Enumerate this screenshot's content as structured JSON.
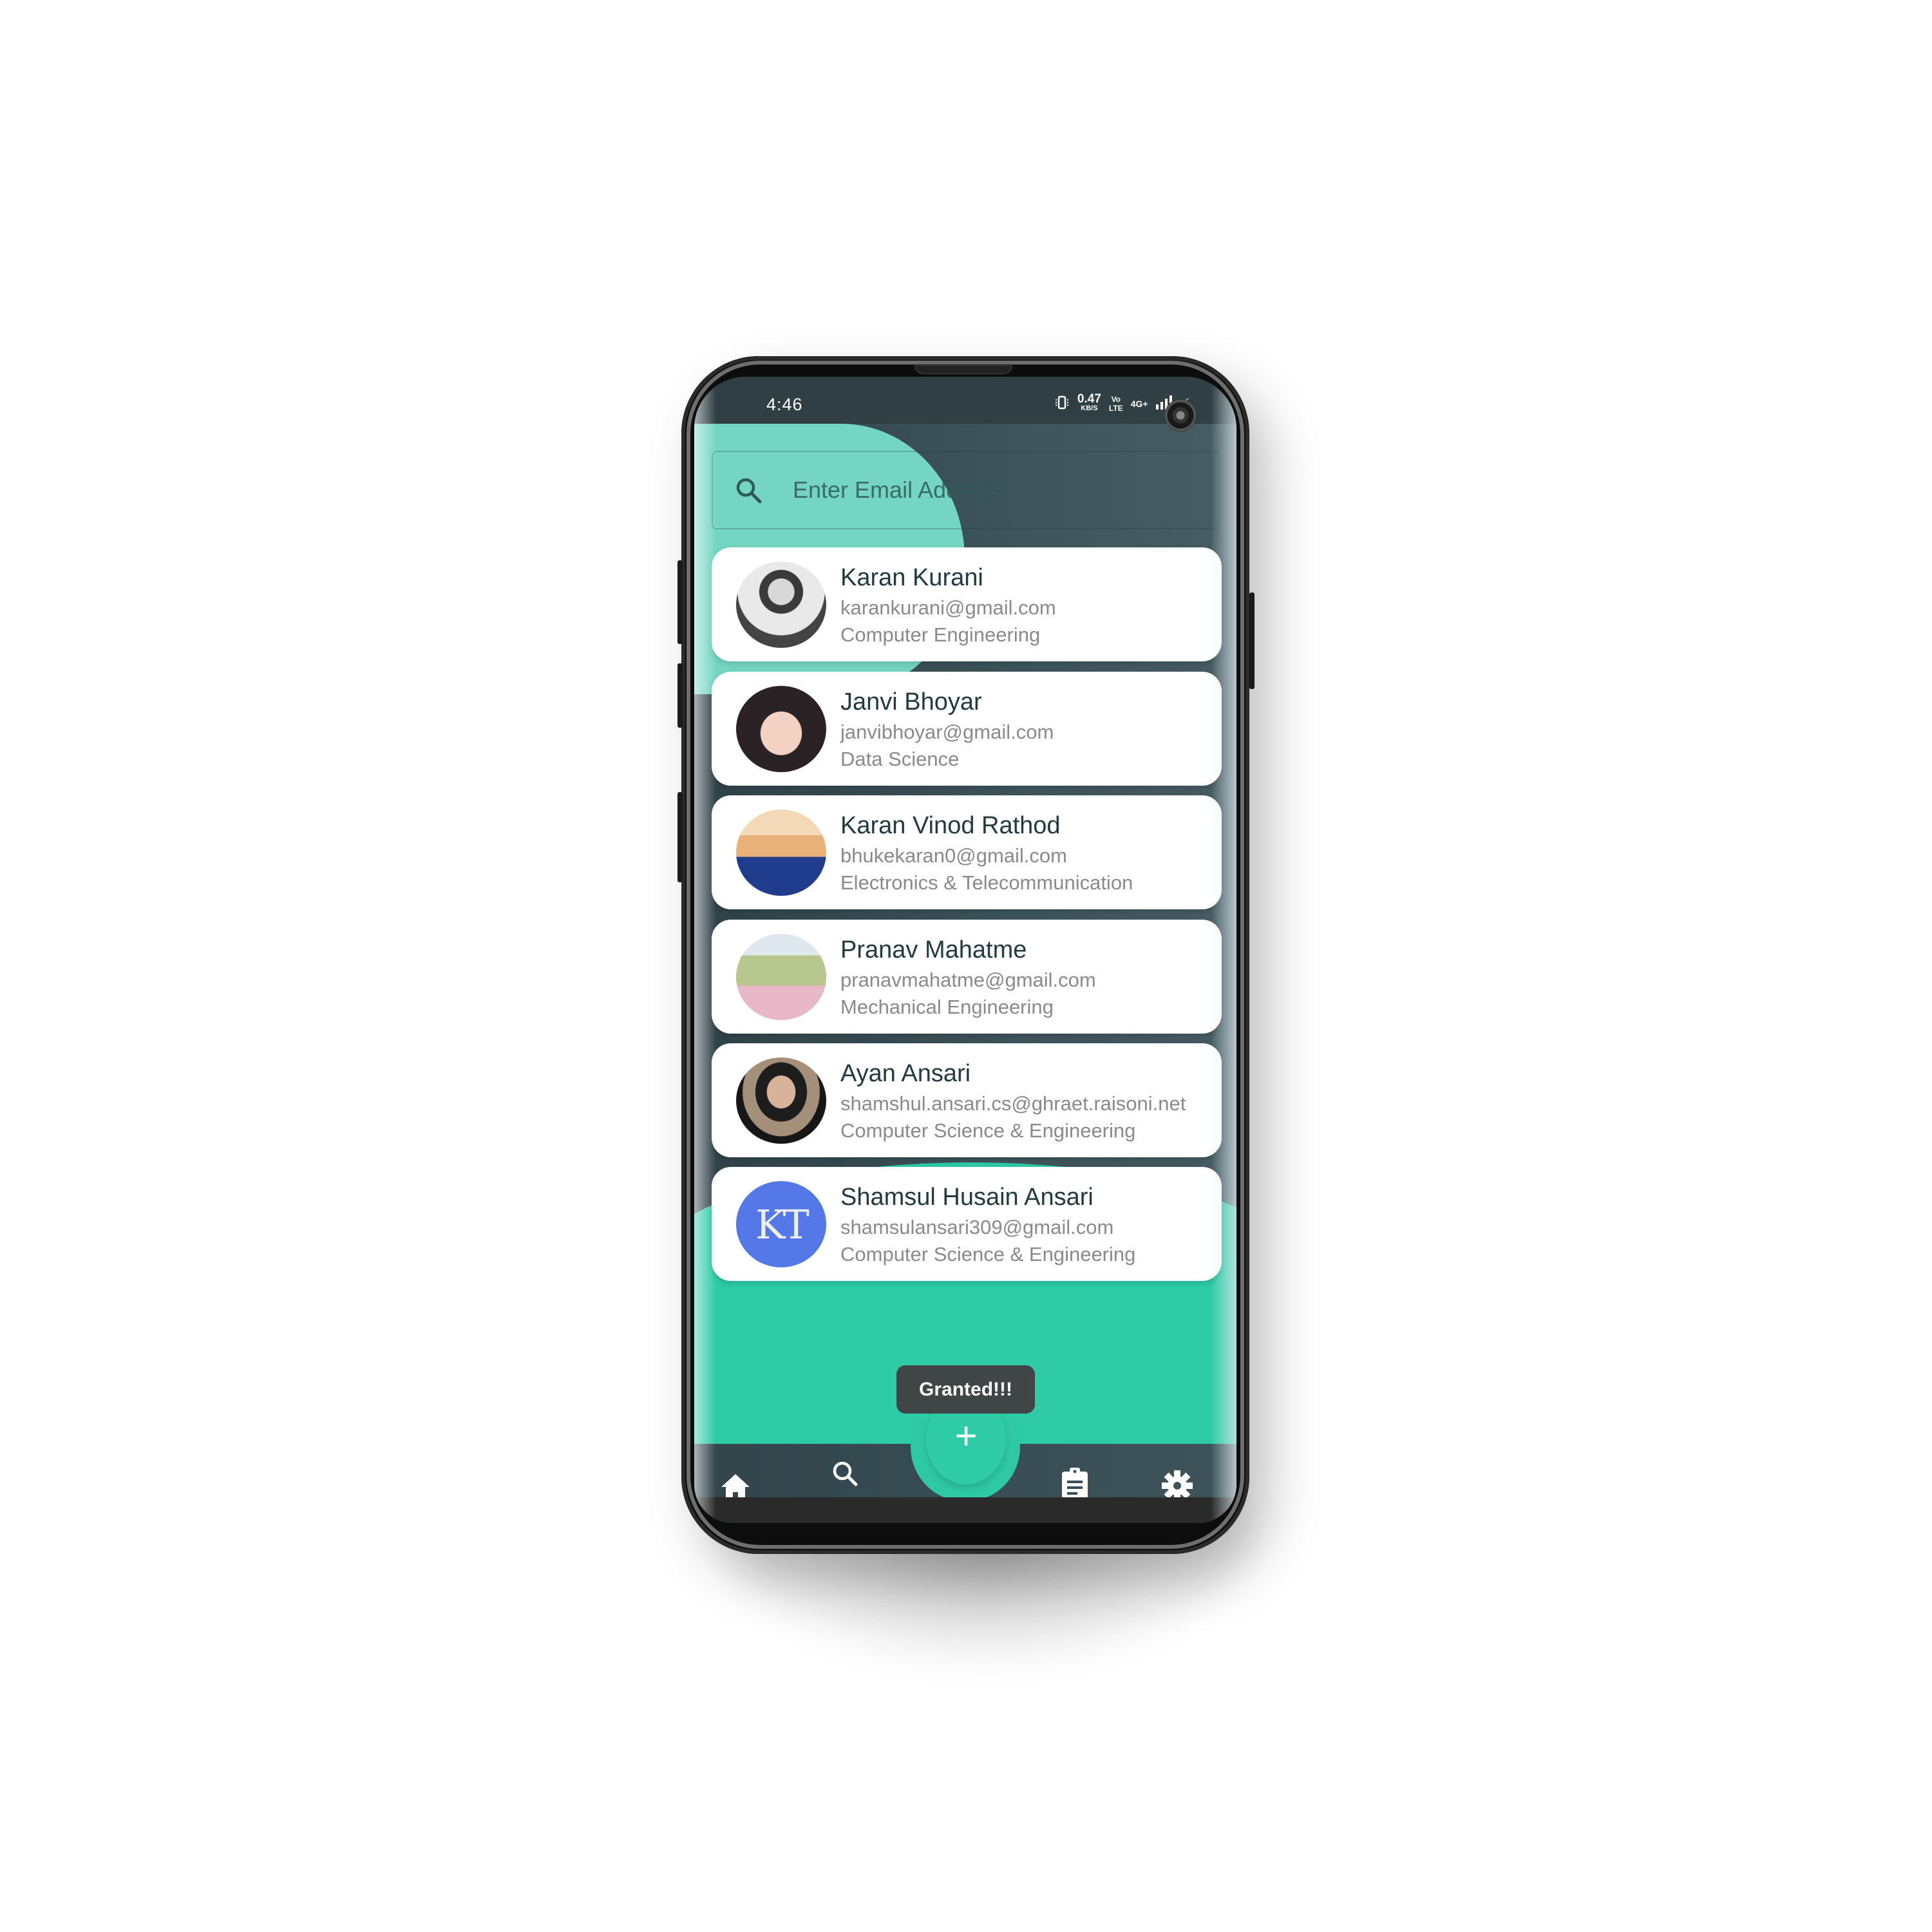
{
  "status_bar": {
    "time": "4:46",
    "speed_value": "0.47",
    "speed_unit": "KB/S",
    "volte_top": "Vo",
    "volte_bottom": "LTE",
    "network": "4G+",
    "icons": [
      "vibrate-icon",
      "signal-icon",
      "battery-charging-icon"
    ]
  },
  "search": {
    "placeholder": "Enter Email Address",
    "icon": "search-icon"
  },
  "contacts": [
    {
      "name": "Karan Kurani",
      "email": "karankurani@gmail.com",
      "department": "Computer Engineering",
      "avatar_style": "grayscale-photo"
    },
    {
      "name": "Janvi Bhoyar",
      "email": "janvibhoyar@gmail.com",
      "department": "Data Science",
      "avatar_style": "color-photo"
    },
    {
      "name": "Karan Vinod Rathod",
      "email": "bhukekaran0@gmail.com",
      "department": "Electronics & Telecommunication",
      "avatar_style": "color-photo"
    },
    {
      "name": "Pranav Mahatme",
      "email": "pranavmahatme@gmail.com",
      "department": "Mechanical Engineering",
      "avatar_style": "color-photo"
    },
    {
      "name": "Ayan Ansari",
      "email": "shamshul.ansari.cs@ghraet.raisoni.net",
      "department": "Computer Science & Engineering",
      "avatar_style": "color-photo"
    },
    {
      "name": "Shamsul Husain Ansari",
      "email": "shamsulansari309@gmail.com",
      "department": "Computer Science & Engineering",
      "avatar_style": "KT-logo"
    }
  ],
  "toast": {
    "text": "Granted!!!"
  },
  "fab": {
    "label": "+",
    "icon": "plus-icon"
  },
  "bottom_nav": {
    "items": [
      {
        "id": "home",
        "icon": "home-icon",
        "label": ""
      },
      {
        "id": "search",
        "icon": "search-icon",
        "label": "Search"
      },
      {
        "id": "clipboard",
        "icon": "clipboard-icon",
        "label": ""
      },
      {
        "id": "settings",
        "icon": "gear-icon",
        "label": ""
      }
    ]
  },
  "colors": {
    "accent_teal": "#2ecba6",
    "light_teal": "#74d6c2",
    "dark_slate": "#31454b",
    "toast_bg": "#404545",
    "name_text": "#233a40",
    "secondary_text": "#8a8a8a",
    "kt_logo_blue": "#5478e8"
  }
}
